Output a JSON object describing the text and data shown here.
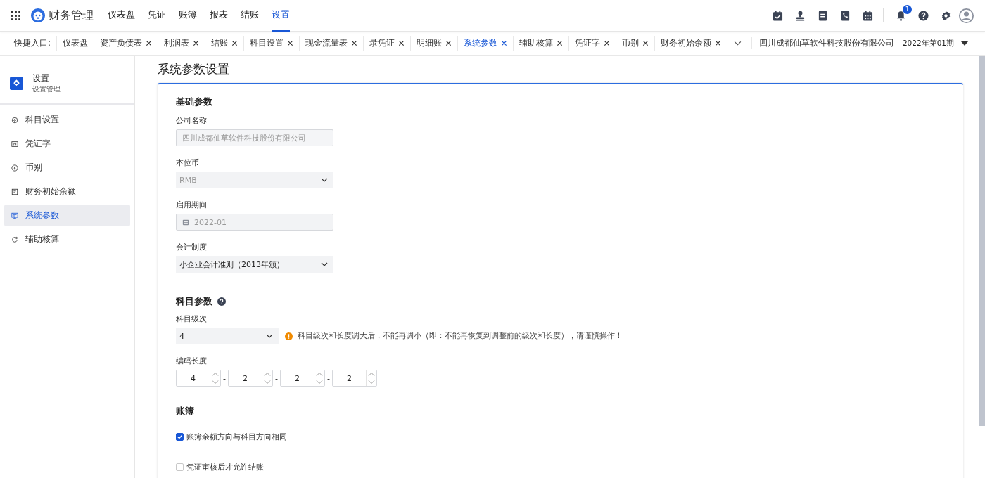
{
  "app_title": "财务管理",
  "nav": [
    {
      "label": "仪表盘",
      "selected": false
    },
    {
      "label": "凭证",
      "selected": false
    },
    {
      "label": "账簿",
      "selected": false
    },
    {
      "label": "报表",
      "selected": false
    },
    {
      "label": "结账",
      "selected": false
    },
    {
      "label": "设置",
      "selected": true
    }
  ],
  "notification_count": "1",
  "quick_entry_label": "快捷入口:",
  "tabs": [
    {
      "label": "仪表盘",
      "closable": false,
      "selected": false
    },
    {
      "label": "资产负债表",
      "closable": true,
      "selected": false
    },
    {
      "label": "利润表",
      "closable": true,
      "selected": false
    },
    {
      "label": "结账",
      "closable": true,
      "selected": false
    },
    {
      "label": "科目设置",
      "closable": true,
      "selected": false
    },
    {
      "label": "现金流量表",
      "closable": true,
      "selected": false
    },
    {
      "label": "录凭证",
      "closable": true,
      "selected": false
    },
    {
      "label": "明细账",
      "closable": true,
      "selected": false
    },
    {
      "label": "系统参数",
      "closable": true,
      "selected": true
    },
    {
      "label": "辅助核算",
      "closable": true,
      "selected": false
    },
    {
      "label": "凭证字",
      "closable": true,
      "selected": false
    },
    {
      "label": "币别",
      "closable": true,
      "selected": false
    },
    {
      "label": "财务初始余额",
      "closable": true,
      "selected": false
    }
  ],
  "company": "四川成都仙草软件科技股份有限公司",
  "period": "2022年第01期",
  "sidebar": {
    "title": "设置",
    "subtitle": "设置管理",
    "items": [
      {
        "label": "科目设置",
        "selected": false
      },
      {
        "label": "凭证字",
        "selected": false
      },
      {
        "label": "币别",
        "selected": false
      },
      {
        "label": "财务初始余额",
        "selected": false
      },
      {
        "label": "系统参数",
        "selected": true
      },
      {
        "label": "辅助核算",
        "selected": false
      }
    ]
  },
  "page_title": "系统参数设置",
  "basic": {
    "title": "基础参数",
    "fields": [
      {
        "label": "公司名称",
        "kind": "input",
        "value": "四川成都仙草软件科技股份有限公司",
        "disabled": true
      },
      {
        "label": "本位币",
        "kind": "select",
        "value": "RMB",
        "disabled": true
      },
      {
        "label": "启用期间",
        "kind": "date",
        "value": "2022-01",
        "disabled": true
      },
      {
        "label": "会计制度",
        "kind": "select",
        "value": "小企业会计准则（2013年颁）",
        "disabled": false
      }
    ]
  },
  "subject": {
    "title": "科目参数",
    "level_label": "科目级次",
    "level_value": "4",
    "warning": "科目级次和长度调大后，不能再调小（即：不能再恢复到调整前的级次和长度），请谨慎操作！",
    "code_length_label": "编码长度",
    "code_lengths": [
      "4",
      "2",
      "2",
      "2"
    ],
    "separators": [
      "-",
      "-",
      "-"
    ]
  },
  "ledger": {
    "title": "账簿",
    "options": [
      {
        "label": "账簿余额方向与科目方向相同",
        "checked": true
      },
      {
        "label": "凭证审核后才允许结账",
        "checked": false
      }
    ]
  }
}
